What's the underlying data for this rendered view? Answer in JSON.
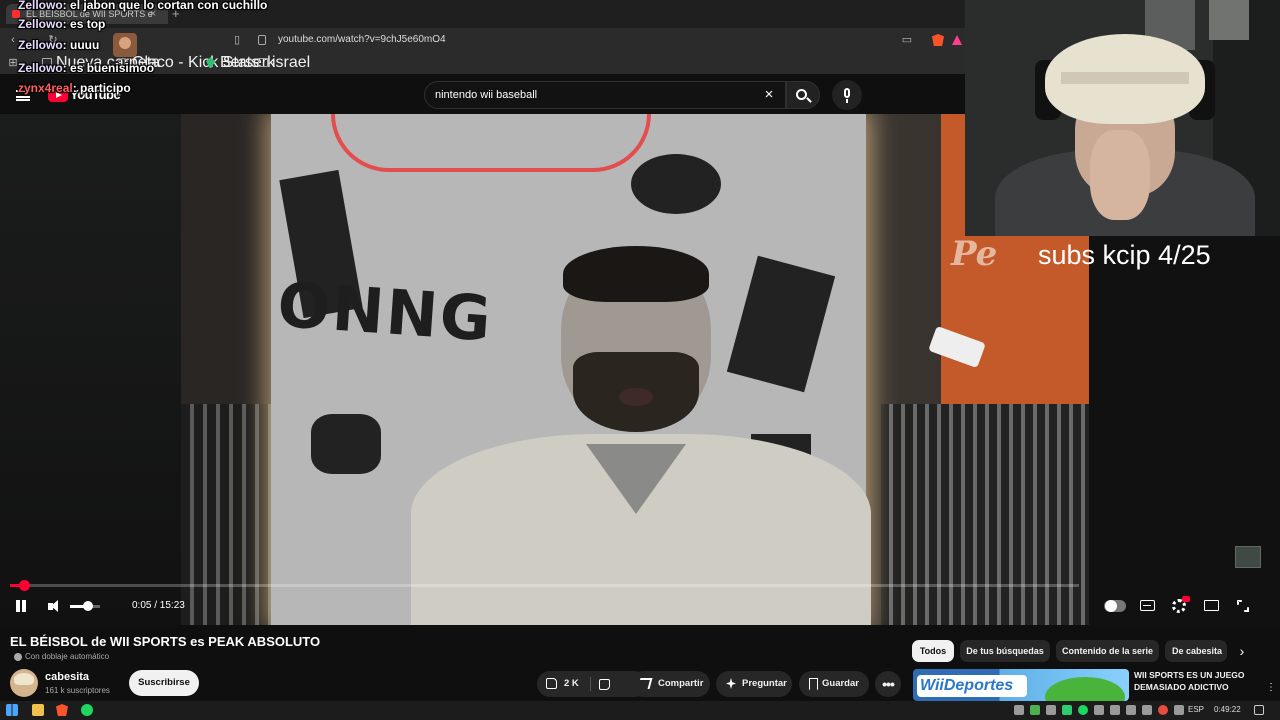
{
  "browser": {
    "tab_title": "EL BÉISBOL de WII SPORTS e",
    "tab_close": "×",
    "new_tab": "+",
    "url": "youtube.com/watch?v=9chJ5e60mO4",
    "bookmarks": [
      "Nueva carpeta",
      "Glaco - Kick Stats",
      "Berserk",
      "israel"
    ]
  },
  "youtube": {
    "logo_text": "YouTube",
    "search_value": "nintendo wii baseball",
    "search_clear": "×"
  },
  "chat": [
    {
      "user": "Zellowo",
      "message": "el jabon que lo cortan con cuchillo"
    },
    {
      "user": "Zellowo",
      "message": "es top"
    },
    {
      "user": "Zellowo",
      "message": "uuuu"
    },
    {
      "user": "Zellowo",
      "message": "es buenisimoo"
    },
    {
      "user": "zynx4real",
      "message": "participo"
    }
  ],
  "overlay": {
    "subs_text": "subs kcip 4/25"
  },
  "video_art": {
    "mural_text": "ONNG",
    "wall_text": "Pe"
  },
  "player": {
    "time": "0:05 / 15:23",
    "progress": 0.005,
    "volume": 0.6
  },
  "video": {
    "title": "EL BÉISBOL de WII SPORTS es PEAK ABSOLUTO",
    "dub_label": "Con doblaje automático",
    "channel_name": "cabesita",
    "channel_subs": "161 k suscriptores",
    "subscribe_label": "Suscribirse",
    "like_count": "2 K",
    "share_label": "Compartir",
    "ask_label": "Preguntar",
    "save_label": "Guardar",
    "more_label": "•••"
  },
  "chips": [
    "Todos",
    "De tus búsquedas",
    "Contenido de la serie",
    "De cabesita"
  ],
  "recommended": {
    "thumb_logo": "WiiDeportes",
    "title": "WII SPORTS ES UN JUEGO DEMASIADO ADICTIVO"
  },
  "taskbar": {
    "language": "ESP",
    "clock": "0:49:22"
  },
  "colors": {
    "accent": "#ff0033",
    "background": "#0f0f0f",
    "chip_bg": "#272727"
  }
}
